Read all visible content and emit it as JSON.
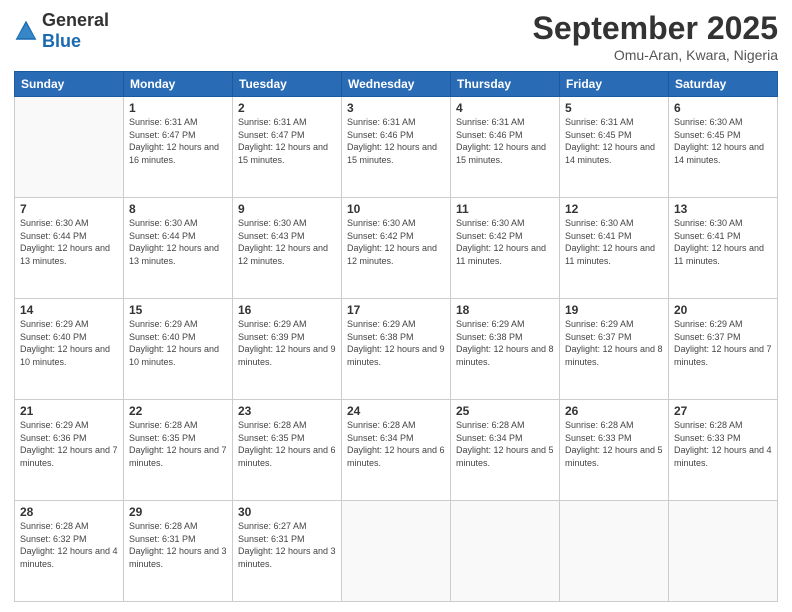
{
  "logo": {
    "general": "General",
    "blue": "Blue"
  },
  "header": {
    "month": "September 2025",
    "location": "Omu-Aran, Kwara, Nigeria"
  },
  "weekdays": [
    "Sunday",
    "Monday",
    "Tuesday",
    "Wednesday",
    "Thursday",
    "Friday",
    "Saturday"
  ],
  "weeks": [
    [
      {
        "day": "",
        "info": ""
      },
      {
        "day": "1",
        "info": "Sunrise: 6:31 AM\nSunset: 6:47 PM\nDaylight: 12 hours and 16 minutes."
      },
      {
        "day": "2",
        "info": "Sunrise: 6:31 AM\nSunset: 6:47 PM\nDaylight: 12 hours and 15 minutes."
      },
      {
        "day": "3",
        "info": "Sunrise: 6:31 AM\nSunset: 6:46 PM\nDaylight: 12 hours and 15 minutes."
      },
      {
        "day": "4",
        "info": "Sunrise: 6:31 AM\nSunset: 6:46 PM\nDaylight: 12 hours and 15 minutes."
      },
      {
        "day": "5",
        "info": "Sunrise: 6:31 AM\nSunset: 6:45 PM\nDaylight: 12 hours and 14 minutes."
      },
      {
        "day": "6",
        "info": "Sunrise: 6:30 AM\nSunset: 6:45 PM\nDaylight: 12 hours and 14 minutes."
      }
    ],
    [
      {
        "day": "7",
        "info": "Sunrise: 6:30 AM\nSunset: 6:44 PM\nDaylight: 12 hours and 13 minutes."
      },
      {
        "day": "8",
        "info": "Sunrise: 6:30 AM\nSunset: 6:44 PM\nDaylight: 12 hours and 13 minutes."
      },
      {
        "day": "9",
        "info": "Sunrise: 6:30 AM\nSunset: 6:43 PM\nDaylight: 12 hours and 12 minutes."
      },
      {
        "day": "10",
        "info": "Sunrise: 6:30 AM\nSunset: 6:42 PM\nDaylight: 12 hours and 12 minutes."
      },
      {
        "day": "11",
        "info": "Sunrise: 6:30 AM\nSunset: 6:42 PM\nDaylight: 12 hours and 11 minutes."
      },
      {
        "day": "12",
        "info": "Sunrise: 6:30 AM\nSunset: 6:41 PM\nDaylight: 12 hours and 11 minutes."
      },
      {
        "day": "13",
        "info": "Sunrise: 6:30 AM\nSunset: 6:41 PM\nDaylight: 12 hours and 11 minutes."
      }
    ],
    [
      {
        "day": "14",
        "info": "Sunrise: 6:29 AM\nSunset: 6:40 PM\nDaylight: 12 hours and 10 minutes."
      },
      {
        "day": "15",
        "info": "Sunrise: 6:29 AM\nSunset: 6:40 PM\nDaylight: 12 hours and 10 minutes."
      },
      {
        "day": "16",
        "info": "Sunrise: 6:29 AM\nSunset: 6:39 PM\nDaylight: 12 hours and 9 minutes."
      },
      {
        "day": "17",
        "info": "Sunrise: 6:29 AM\nSunset: 6:38 PM\nDaylight: 12 hours and 9 minutes."
      },
      {
        "day": "18",
        "info": "Sunrise: 6:29 AM\nSunset: 6:38 PM\nDaylight: 12 hours and 8 minutes."
      },
      {
        "day": "19",
        "info": "Sunrise: 6:29 AM\nSunset: 6:37 PM\nDaylight: 12 hours and 8 minutes."
      },
      {
        "day": "20",
        "info": "Sunrise: 6:29 AM\nSunset: 6:37 PM\nDaylight: 12 hours and 7 minutes."
      }
    ],
    [
      {
        "day": "21",
        "info": "Sunrise: 6:29 AM\nSunset: 6:36 PM\nDaylight: 12 hours and 7 minutes."
      },
      {
        "day": "22",
        "info": "Sunrise: 6:28 AM\nSunset: 6:35 PM\nDaylight: 12 hours and 7 minutes."
      },
      {
        "day": "23",
        "info": "Sunrise: 6:28 AM\nSunset: 6:35 PM\nDaylight: 12 hours and 6 minutes."
      },
      {
        "day": "24",
        "info": "Sunrise: 6:28 AM\nSunset: 6:34 PM\nDaylight: 12 hours and 6 minutes."
      },
      {
        "day": "25",
        "info": "Sunrise: 6:28 AM\nSunset: 6:34 PM\nDaylight: 12 hours and 5 minutes."
      },
      {
        "day": "26",
        "info": "Sunrise: 6:28 AM\nSunset: 6:33 PM\nDaylight: 12 hours and 5 minutes."
      },
      {
        "day": "27",
        "info": "Sunrise: 6:28 AM\nSunset: 6:33 PM\nDaylight: 12 hours and 4 minutes."
      }
    ],
    [
      {
        "day": "28",
        "info": "Sunrise: 6:28 AM\nSunset: 6:32 PM\nDaylight: 12 hours and 4 minutes."
      },
      {
        "day": "29",
        "info": "Sunrise: 6:28 AM\nSunset: 6:31 PM\nDaylight: 12 hours and 3 minutes."
      },
      {
        "day": "30",
        "info": "Sunrise: 6:27 AM\nSunset: 6:31 PM\nDaylight: 12 hours and 3 minutes."
      },
      {
        "day": "",
        "info": ""
      },
      {
        "day": "",
        "info": ""
      },
      {
        "day": "",
        "info": ""
      },
      {
        "day": "",
        "info": ""
      }
    ]
  ]
}
